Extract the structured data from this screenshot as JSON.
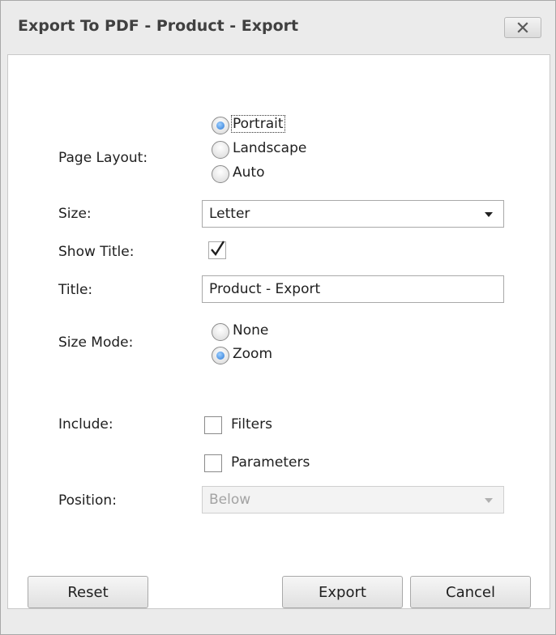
{
  "dialog": {
    "title": "Export To PDF - Product - Export",
    "close_icon": "close-icon"
  },
  "form": {
    "page_layout": {
      "label": "Page Layout:",
      "options": [
        "Portrait",
        "Landscape",
        "Auto"
      ],
      "selected": "Portrait"
    },
    "size": {
      "label": "Size:",
      "value": "Letter"
    },
    "show_title": {
      "label": "Show Title:",
      "checked": true
    },
    "title": {
      "label": "Title:",
      "value": "Product - Export"
    },
    "size_mode": {
      "label": "Size Mode:",
      "options": [
        "None",
        "Zoom"
      ],
      "selected": "Zoom"
    },
    "include": {
      "label": "Include:",
      "options": [
        {
          "label": "Filters",
          "checked": false
        },
        {
          "label": "Parameters",
          "checked": false
        }
      ]
    },
    "position": {
      "label": "Position:",
      "value": "Below",
      "disabled": true
    }
  },
  "buttons": {
    "reset": "Reset",
    "export": "Export",
    "cancel": "Cancel"
  },
  "colors": {
    "radio_selected": "#2a78d6",
    "disabled_text": "#a3a3a3"
  }
}
